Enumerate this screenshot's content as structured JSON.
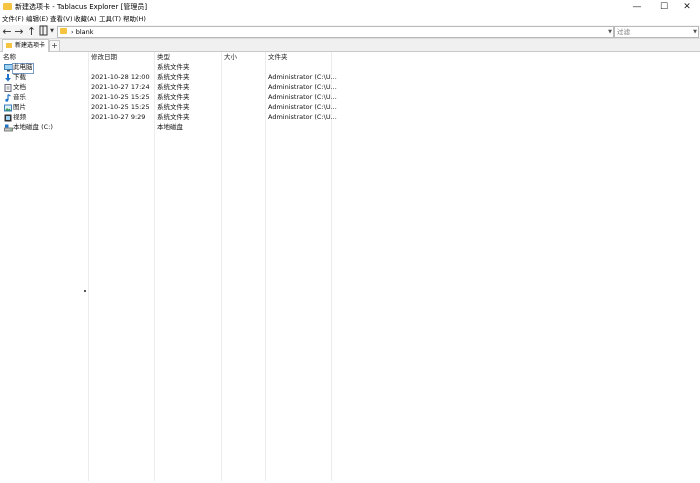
{
  "window": {
    "title": "新建选项卡 - Tablacus Explorer [管理员]",
    "minimize": "—",
    "maximize": "☐",
    "close": "✕"
  },
  "menu": [
    "文件(F)",
    "编辑(E)",
    "查看(V)",
    "收藏(A)",
    "工具(T)",
    "帮助(H)"
  ],
  "toolbar": {
    "back": "←",
    "forward": "→",
    "up": "↑",
    "address": "blank",
    "address_chevron": "›",
    "filter_placeholder": "过滤",
    "dropdown": "▼"
  },
  "tabs": {
    "active_label": "新建选项卡",
    "add": "+"
  },
  "list": {
    "columns": [
      "名称",
      "修改日期",
      "类型",
      "大小",
      "文件夹"
    ],
    "rows": [
      {
        "icon": "this-pc-icon",
        "name": "此电脑",
        "date": "",
        "type": "系统文件夹",
        "size": "",
        "folder": ""
      },
      {
        "icon": "download-icon",
        "name": "下载",
        "date": "2021-10-28 12:00",
        "type": "系统文件夹",
        "size": "",
        "folder": "Administrator (C:\\U..."
      },
      {
        "icon": "document-icon",
        "name": "文档",
        "date": "2021-10-27 17:24",
        "type": "系统文件夹",
        "size": "",
        "folder": "Administrator (C:\\U..."
      },
      {
        "icon": "music-icon",
        "name": "音乐",
        "date": "2021-10-25 15:25",
        "type": "系统文件夹",
        "size": "",
        "folder": "Administrator (C:\\U..."
      },
      {
        "icon": "picture-icon",
        "name": "图片",
        "date": "2021-10-25 15:25",
        "type": "系统文件夹",
        "size": "",
        "folder": "Administrator (C:\\U..."
      },
      {
        "icon": "video-icon",
        "name": "视频",
        "date": "2021-10-27 9:29",
        "type": "系统文件夹",
        "size": "",
        "folder": "Administrator (C:\\U..."
      },
      {
        "icon": "drive-icon",
        "name": "本地磁盘 (C:)",
        "date": "",
        "type": "本地磁盘",
        "size": "",
        "folder": ""
      }
    ]
  }
}
